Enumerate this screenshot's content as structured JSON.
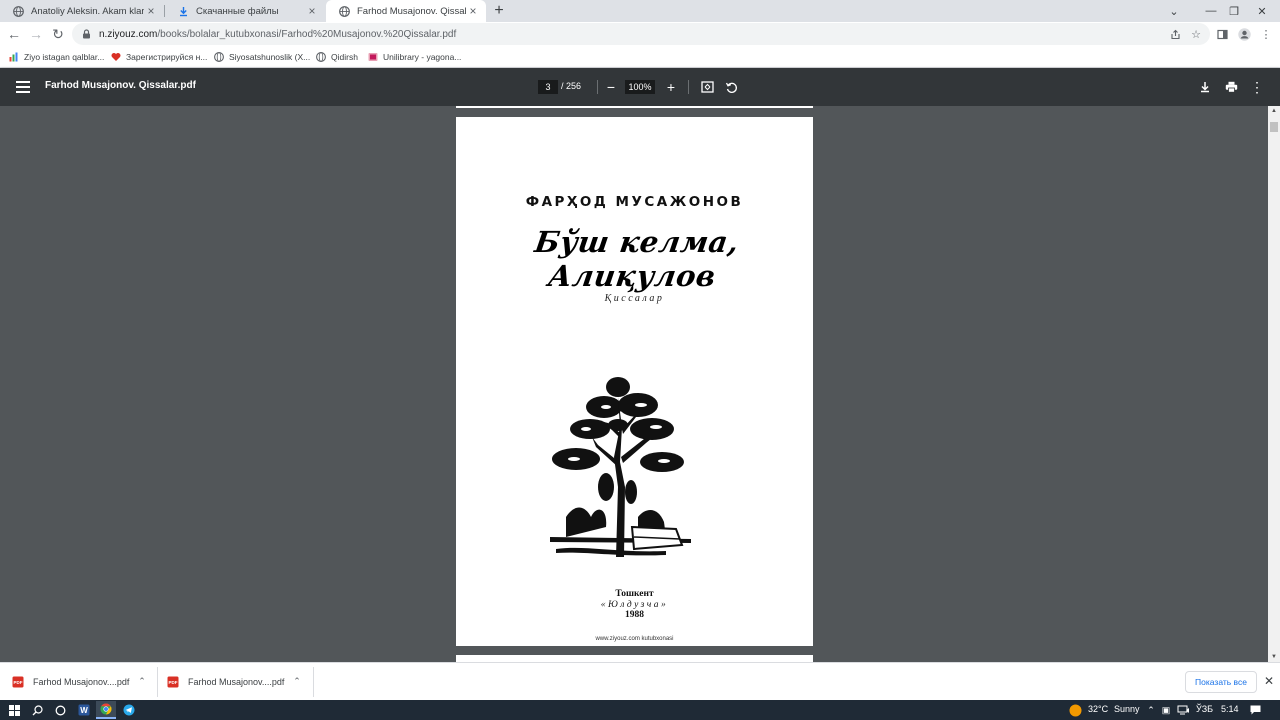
{
  "browser": {
    "tabs": [
      {
        "title": "Anatoliy Aleksin. Akam klarnet ch",
        "icon": "globe-icon",
        "active": false
      },
      {
        "title": "Скачанные файлы",
        "icon": "download-icon",
        "active": false
      },
      {
        "title": "Farhod Musajonov. Qissalar.pdf",
        "icon": "globe-icon",
        "active": true
      }
    ],
    "url_host": "n.ziyouz.com",
    "url_path": "/books/bolalar_kutubxonasi/Farhod%20Musajonov.%20Qissalar.pdf",
    "bookmarks": [
      {
        "label": "Ziyo istagan qalblar...",
        "icon": "chart-bookmark-icon"
      },
      {
        "label": "Зарегистрируйся н...",
        "icon": "heart-bookmark-icon"
      },
      {
        "label": "Siyosatshunoslik (X...",
        "icon": "globe-icon"
      },
      {
        "label": "Qidirsh",
        "icon": "globe-icon"
      },
      {
        "label": "Unilibrary - yagona...",
        "icon": "book-bookmark-icon"
      }
    ]
  },
  "pdf": {
    "file_title": "Farhod Musajonov. Qissalar.pdf",
    "current_page": "3",
    "total_pages": "/ 256",
    "zoom": "100%"
  },
  "page_content": {
    "author": "ФАРҲОД МУСАЖОНОВ",
    "title": "Бўш келма, Алиқулов",
    "genre": "Қиссалар",
    "city": "Тошкент",
    "publisher": "«Юлдузча»",
    "year": "1988",
    "footer": "www.ziyouz.com kutubxonasi"
  },
  "downloads": {
    "items": [
      "Farhod Musajonov....pdf",
      "Farhod Musajonov....pdf"
    ],
    "show_all": "Показать все"
  },
  "taskbar": {
    "temperature": "32°C",
    "weather": "Sunny",
    "language": "ЎЗБ",
    "time": "5:14"
  },
  "colors": {
    "pdf_toolbar": "#323639",
    "viewer_bg": "#525659",
    "link_blue": "#1a73e8",
    "taskbar": "#1f2a36"
  }
}
